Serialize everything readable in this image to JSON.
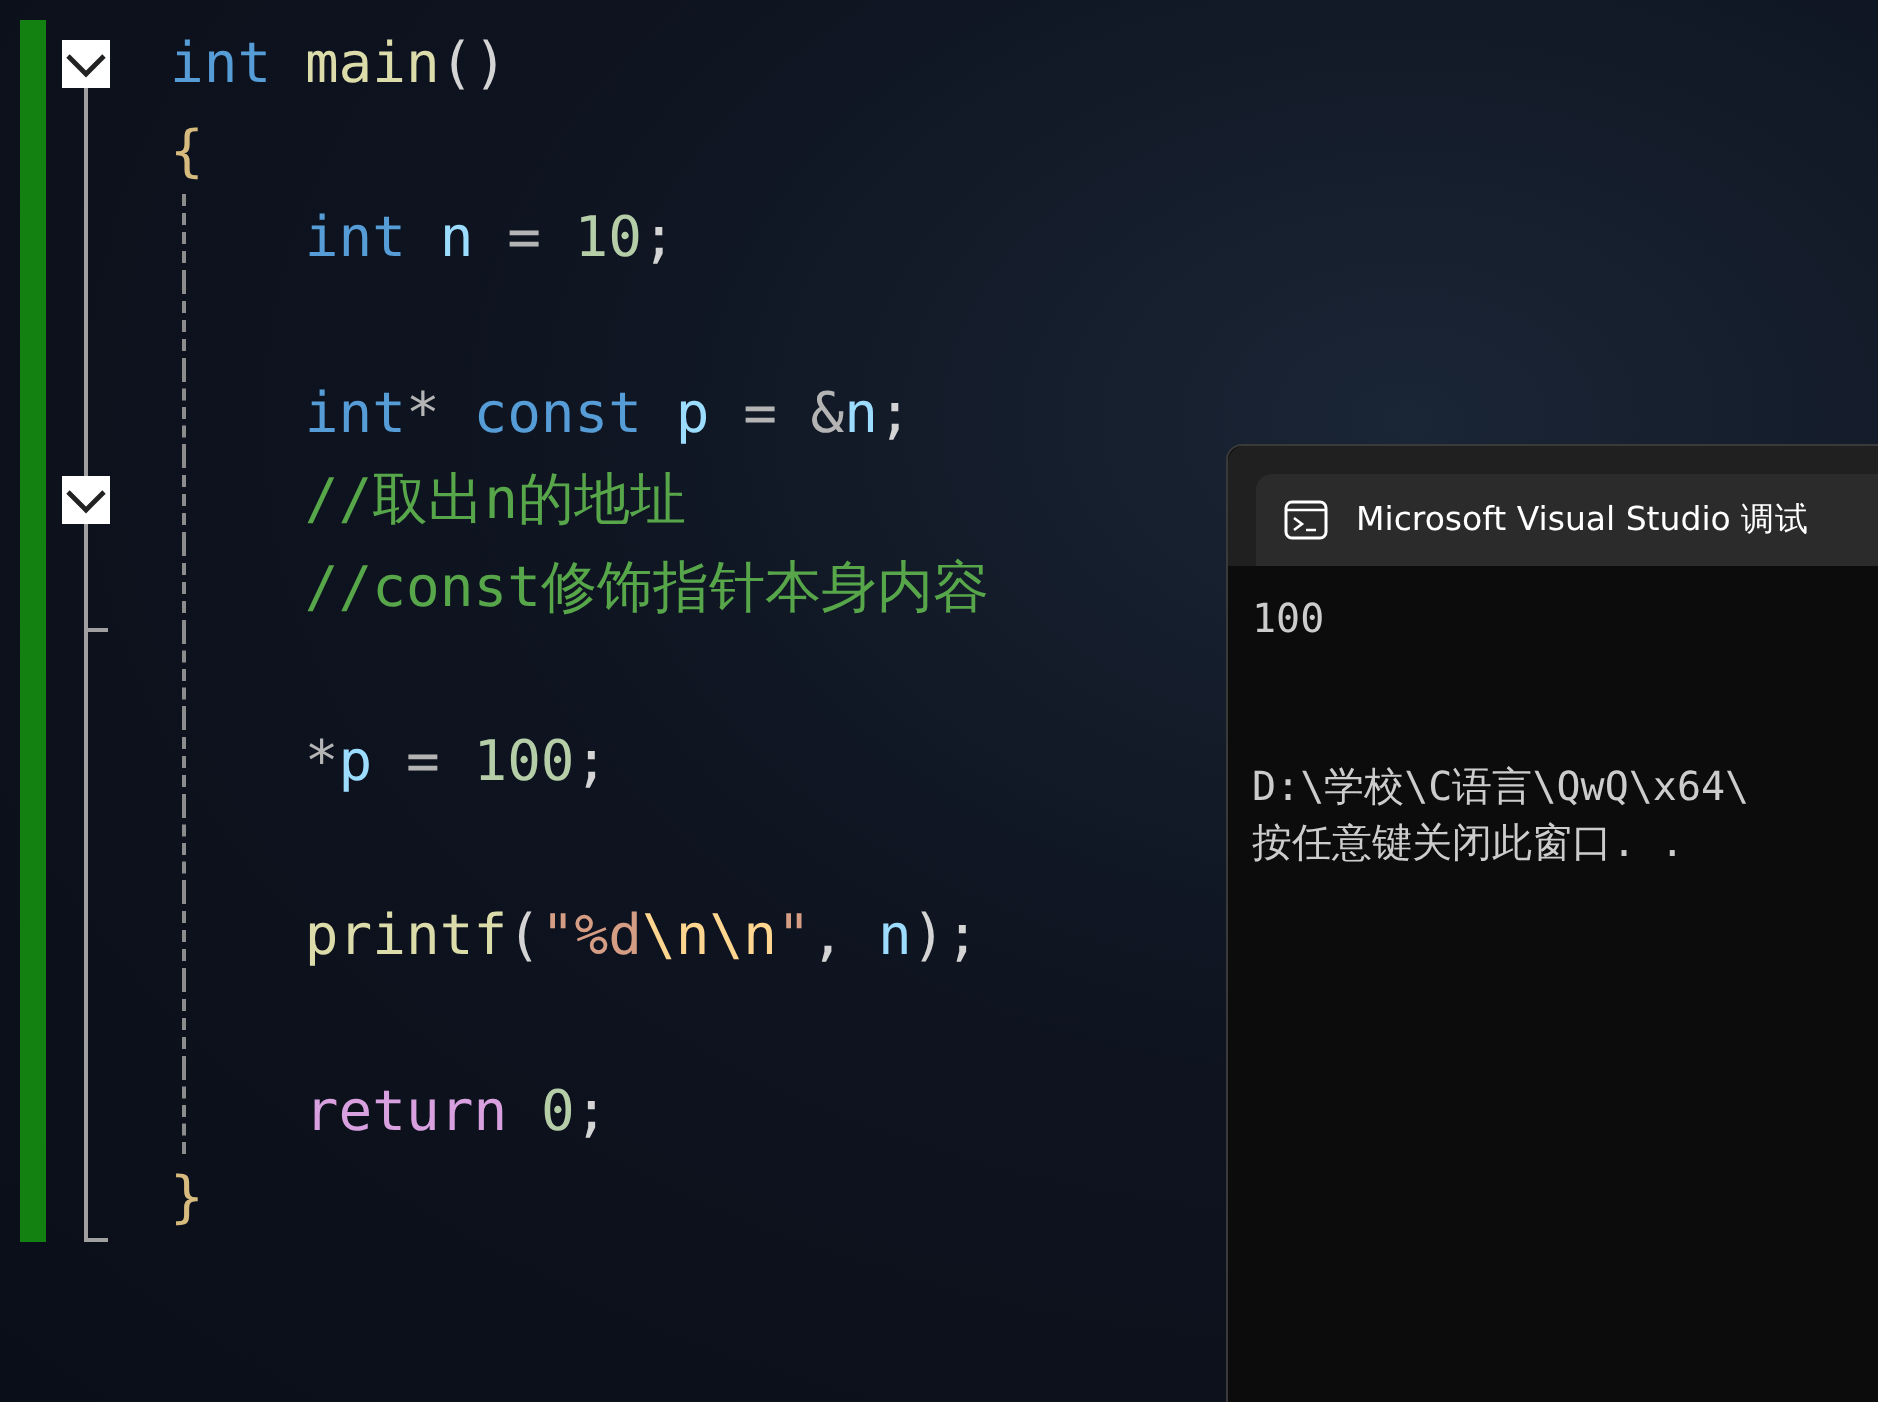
{
  "editor": {
    "changed": true,
    "code": [
      {
        "kind": "line",
        "expanded": true,
        "tokens": [
          {
            "t": "int ",
            "kind": "keyword"
          },
          {
            "t": "main",
            "kind": "function"
          },
          {
            "t": "()",
            "kind": "punct"
          }
        ]
      },
      {
        "kind": "line",
        "tokens": [
          {
            "t": "{",
            "kind": "brace"
          }
        ]
      },
      {
        "kind": "block",
        "children": [
          {
            "kind": "line",
            "tokens": [
              {
                "t": "int ",
                "kind": "keyword"
              },
              {
                "t": "n",
                "kind": "variable"
              },
              {
                "t": " = ",
                "kind": "operator"
              },
              {
                "t": "10",
                "kind": "number"
              },
              {
                "t": ";",
                "kind": "punct"
              }
            ]
          },
          {
            "kind": "blank"
          },
          {
            "kind": "line",
            "tokens": [
              {
                "t": "int",
                "kind": "keyword"
              },
              {
                "t": "* ",
                "kind": "operator"
              },
              {
                "t": "const ",
                "kind": "keyword"
              },
              {
                "t": "p",
                "kind": "variable"
              },
              {
                "t": " = &",
                "kind": "operator"
              },
              {
                "t": "n",
                "kind": "variable"
              },
              {
                "t": ";",
                "kind": "punct"
              }
            ]
          },
          {
            "kind": "line",
            "expanded": true,
            "tokens": [
              {
                "t": "//取出n的地址",
                "kind": "comment"
              }
            ]
          },
          {
            "kind": "line",
            "fold_end": true,
            "tokens": [
              {
                "t": "//const修饰指针本身内容",
                "kind": "comment"
              }
            ]
          },
          {
            "kind": "blank"
          },
          {
            "kind": "line",
            "tokens": [
              {
                "t": "*",
                "kind": "operator"
              },
              {
                "t": "p",
                "kind": "variable"
              },
              {
                "t": " = ",
                "kind": "operator"
              },
              {
                "t": "100",
                "kind": "number"
              },
              {
                "t": ";",
                "kind": "punct"
              }
            ]
          },
          {
            "kind": "blank"
          },
          {
            "kind": "line",
            "tokens": [
              {
                "t": "printf",
                "kind": "function"
              },
              {
                "t": "(",
                "kind": "punct"
              },
              {
                "t": "\"%d",
                "kind": "string"
              },
              {
                "t": "\\n\\n",
                "kind": "escape"
              },
              {
                "t": "\"",
                "kind": "string"
              },
              {
                "t": ", ",
                "kind": "punct"
              },
              {
                "t": "n",
                "kind": "variable"
              },
              {
                "t": ");",
                "kind": "punct"
              }
            ]
          },
          {
            "kind": "blank"
          },
          {
            "kind": "line",
            "tokens": [
              {
                "t": "return ",
                "kind": "control"
              },
              {
                "t": "0",
                "kind": "number"
              },
              {
                "t": ";",
                "kind": "punct"
              }
            ]
          }
        ]
      },
      {
        "kind": "line",
        "fold_end": true,
        "tokens": [
          {
            "t": "}",
            "kind": "brace"
          }
        ]
      }
    ]
  },
  "console": {
    "title": "Microsoft Visual Studio 调试",
    "lines": [
      {
        "kind": "text",
        "text": "100"
      },
      {
        "kind": "blank"
      },
      {
        "kind": "blank"
      },
      {
        "kind": "text",
        "text": "D:\\学校\\C语言\\QwQ\\x64\\"
      },
      {
        "kind": "text",
        "text": "按任意键关闭此窗口. ."
      }
    ]
  }
}
